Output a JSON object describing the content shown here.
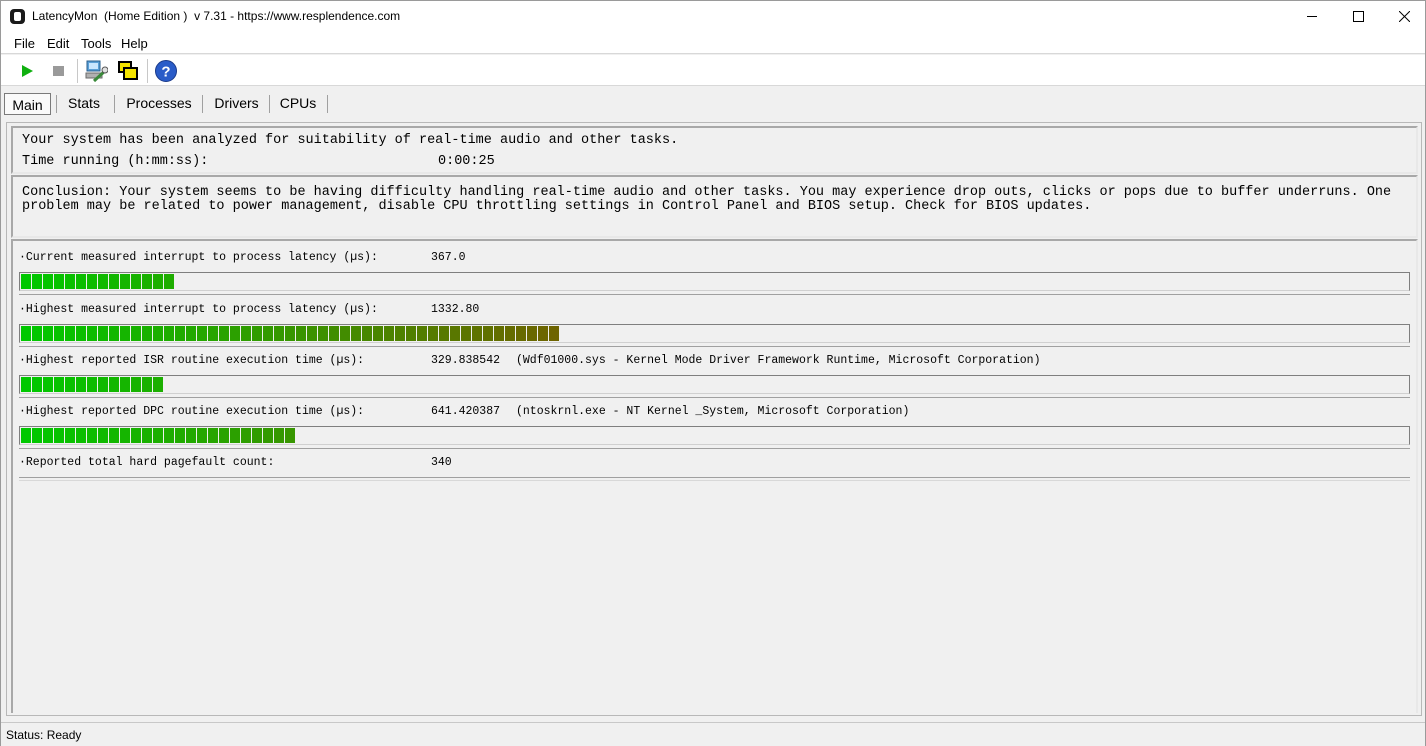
{
  "window": {
    "title": "LatencyMon  (Home Edition )  v 7.31 - https://www.resplendence.com"
  },
  "menu": [
    "File",
    "Edit",
    "Tools",
    "Help"
  ],
  "toolbar": {
    "icons": [
      "play-icon",
      "stop-icon",
      "computer-wrench-icon",
      "windows-icon",
      "help-icon"
    ]
  },
  "tabs": [
    "Main",
    "Stats",
    "Processes",
    "Drivers",
    "CPUs"
  ],
  "main": {
    "analysis_text": "Your system has been analyzed for suitability of real-time audio and other tasks.",
    "time_running_label": "Time running (h:mm:ss):",
    "time_running_value": "0:00:25",
    "conclusion": "Conclusion: Your system seems to be having difficulty handling real-time audio and other tasks. You may experience drop outs, clicks or pops due to buffer underruns. One\nproblem may be related to power management, disable CPU throttling settings in Control Panel and BIOS setup. Check for BIOS updates."
  },
  "metrics": [
    {
      "label": "·Current measured interrupt to process latency (µs):",
      "value": "367.0",
      "desc": "",
      "segments": 14
    },
    {
      "label": "·Highest measured interrupt to process latency (µs):",
      "value": "1332.80",
      "desc": "",
      "segments": 49
    },
    {
      "label": "·Highest reported ISR routine execution time (µs):",
      "value": "329.838542",
      "desc": "(Wdf01000.sys - Kernel Mode Driver Framework Runtime, Microsoft Corporation)",
      "segments": 13
    },
    {
      "label": "·Highest reported DPC routine execution time (µs):",
      "value": "641.420387",
      "desc": "(ntoskrnl.exe - NT Kernel _System, Microsoft Corporation)",
      "segments": 25
    },
    {
      "label": "·Reported total hard pagefault count:",
      "value": "340",
      "desc": "",
      "segments": 0
    }
  ],
  "colors": {
    "bar_green": "#00c800",
    "bar_olive": "#6e6400",
    "play_green": "#10b010",
    "help_blue": "#2a5cc8"
  },
  "status": {
    "text": "Status: Ready"
  }
}
